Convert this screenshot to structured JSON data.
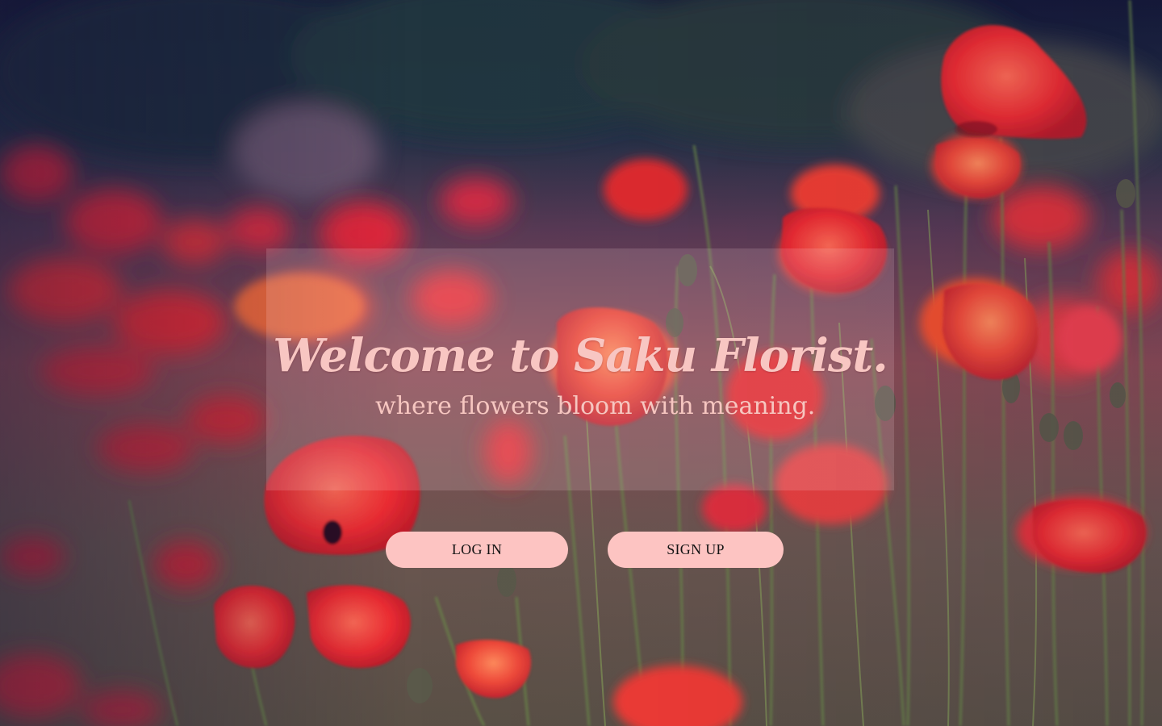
{
  "hero": {
    "title": "Welcome to Saku Florist.",
    "subtitle": "where flowers bloom with meaning."
  },
  "actions": {
    "login_label": "LOG IN",
    "signup_label": "SIGN UP"
  },
  "colors": {
    "button_bg": "#fdc4c2",
    "title_color": "#f8c6c2",
    "poppy_red": "#e8282d",
    "sky_dark": "#141838"
  }
}
